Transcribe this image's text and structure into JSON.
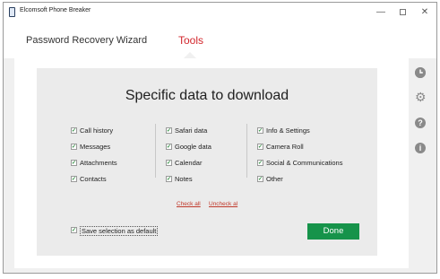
{
  "window": {
    "title": "Elcomsoft Phone Breaker",
    "minimize": "—",
    "close": "✕"
  },
  "nav": {
    "wizard": "Password Recovery Wizard",
    "tools": "Tools"
  },
  "panel": {
    "title": "Specific data to download",
    "columns": [
      [
        {
          "label": "Call history",
          "checked": true
        },
        {
          "label": "Messages",
          "checked": true
        },
        {
          "label": "Attachments",
          "checked": true
        },
        {
          "label": "Contacts",
          "checked": true
        }
      ],
      [
        {
          "label": "Safari data",
          "checked": true
        },
        {
          "label": "Google data",
          "checked": true
        },
        {
          "label": "Calendar",
          "checked": true
        },
        {
          "label": "Notes",
          "checked": true
        }
      ],
      [
        {
          "label": "Info & Settings",
          "checked": true
        },
        {
          "label": "Camera Roll",
          "checked": true
        },
        {
          "label": "Social & Communications",
          "checked": true
        },
        {
          "label": "Other",
          "checked": true
        }
      ]
    ],
    "check_all": "Check all",
    "uncheck_all": "Uncheck al",
    "save_default": "Save selection as default",
    "done": "Done",
    "check_mark": "✓"
  },
  "sidebar": {
    "info": "i",
    "help": "?",
    "gear": "⚙"
  },
  "colors": {
    "accent_red": "#d2262c",
    "done_green": "#16934a"
  }
}
